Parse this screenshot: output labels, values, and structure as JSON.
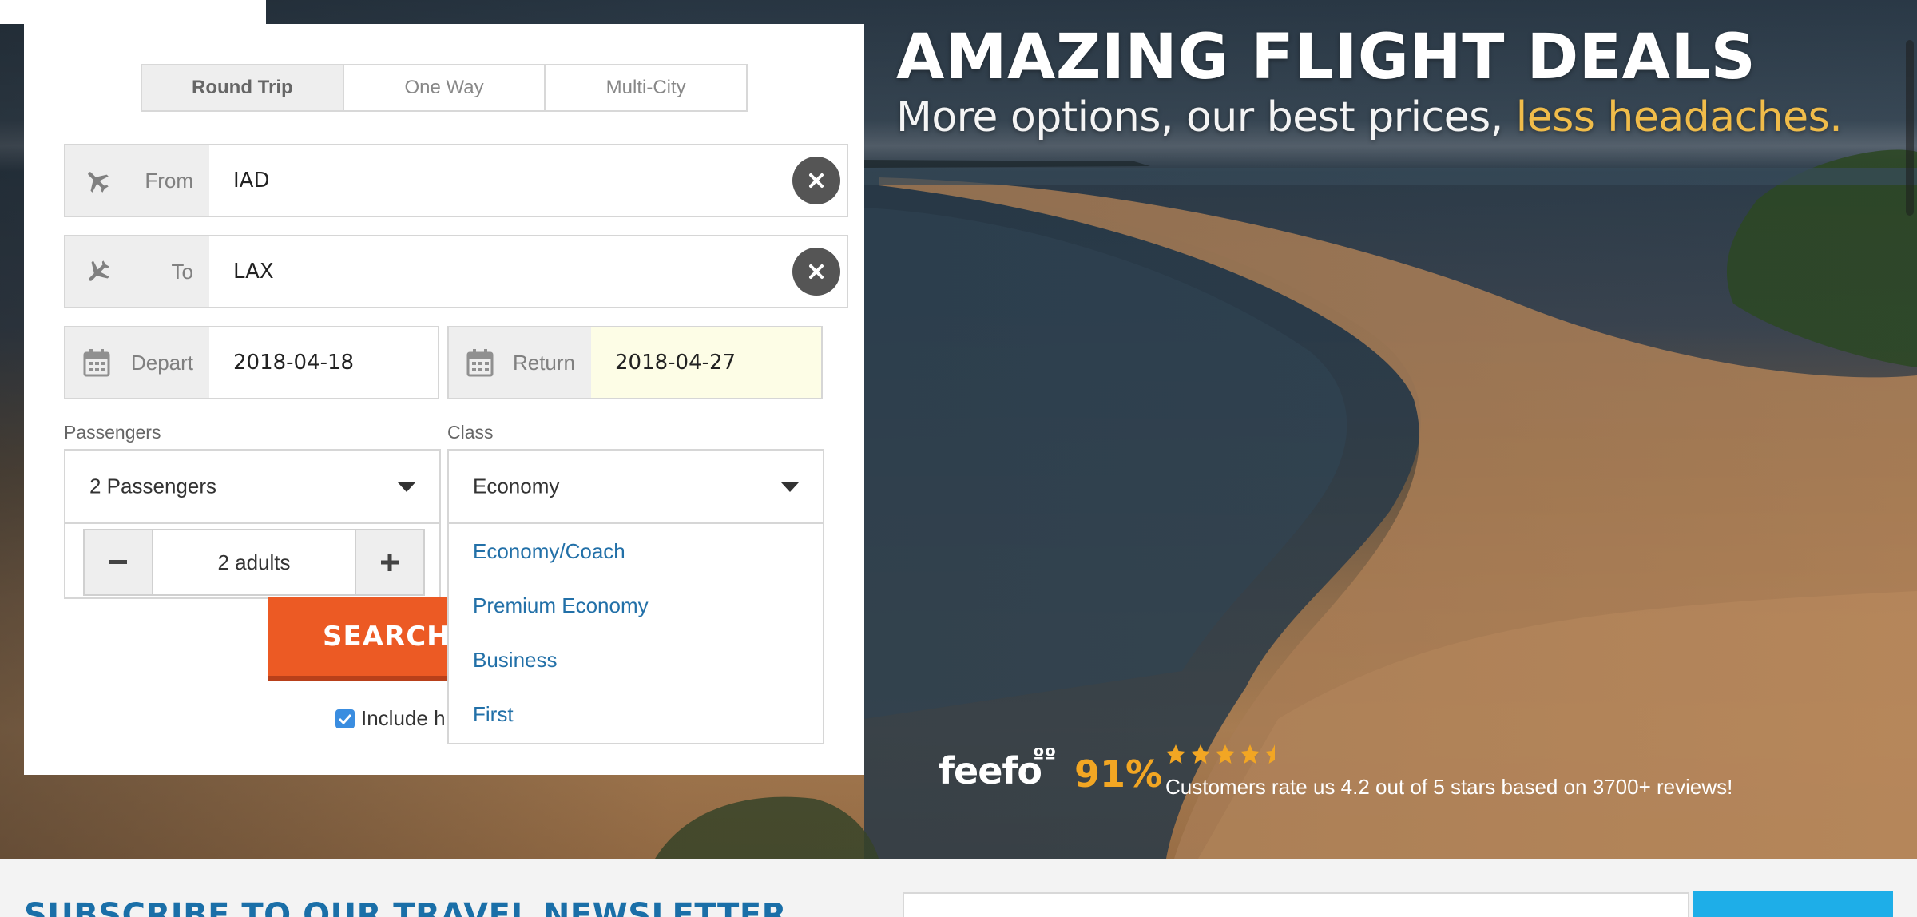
{
  "hero": {
    "headline": "AMAZING FLIGHT DEALS",
    "subline_main": "More options, our best prices, ",
    "subline_accent": "less headaches."
  },
  "search": {
    "trip_tabs": [
      {
        "label": "Round Trip",
        "active": true
      },
      {
        "label": "One Way",
        "active": false
      },
      {
        "label": "Multi-City",
        "active": false
      }
    ],
    "from": {
      "label": "From",
      "value": "IAD"
    },
    "to": {
      "label": "To",
      "value": "LAX"
    },
    "depart": {
      "label": "Depart",
      "value": "2018-04-18"
    },
    "return": {
      "label": "Return",
      "value": "2018-04-27"
    },
    "passengers": {
      "label": "Passengers",
      "selected": "2 Passengers",
      "stepper_value": "2 adults"
    },
    "class": {
      "label": "Class",
      "selected": "Economy",
      "options": [
        "Economy/Coach",
        "Premium Economy",
        "Business",
        "First"
      ]
    },
    "search_button": "SEARCH",
    "include_label": "Include h",
    "include_checked": true
  },
  "feefo": {
    "logo": "feefo",
    "eyes": "ºº",
    "percent": "91%",
    "stars": "★★★★★",
    "rating": 4.2,
    "text": "Customers rate us 4.2 out of 5 stars based on 3700+ reviews!"
  },
  "newsletter": {
    "title": "SUBSCRIBE TO OUR TRAVEL NEWSLETTER"
  },
  "colors": {
    "accent_orange": "#ec5a24",
    "link_blue": "#2270a8",
    "star_gold": "#f2a623",
    "subline_accent": "#f0bc4a",
    "newsletter_blue": "#1a6fa8",
    "newsletter_button": "#1eaee8"
  },
  "icons": {
    "from": "plane-takeoff-icon",
    "to": "plane-landing-icon",
    "calendar": "calendar-icon",
    "clear": "close-icon",
    "caret": "caret-down-icon",
    "minus": "minus-icon",
    "plus": "plus-icon",
    "check": "check-icon"
  }
}
